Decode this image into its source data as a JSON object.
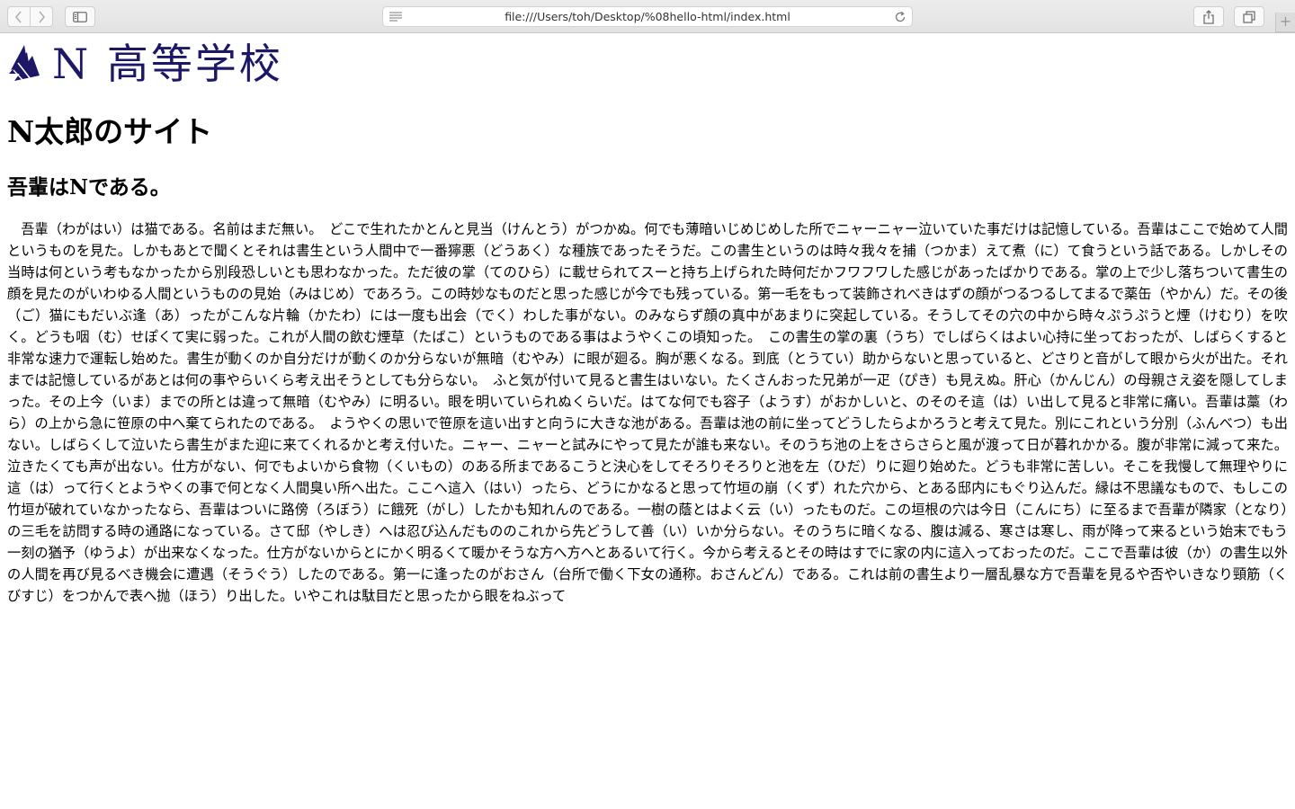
{
  "browser": {
    "url": "file:///Users/toh/Desktop/%08hello-html/index.html",
    "new_tab_label": "+"
  },
  "logo": {
    "text": "N 高等学校",
    "color": "#1c1766"
  },
  "page": {
    "h1": "N太郎のサイト",
    "h2": "吾輩はNである。",
    "paragraph": "　吾輩（わがはい）は猫である。名前はまだ無い。　どこで生れたかとんと見当（けんとう）がつかぬ。何でも薄暗いじめじめした所でニャーニャー泣いていた事だけは記憶している。吾輩はここで始めて人間というものを見た。しかもあとで聞くとそれは書生という人間中で一番獰悪（どうあく）な種族であったそうだ。この書生というのは時々我々を捕（つかま）えて煮（に）て食うという話である。しかしその当時は何という考もなかったから別段恐しいとも思わなかった。ただ彼の掌（てのひら）に載せられてスーと持ち上げられた時何だかフワフワした感じがあったばかりである。掌の上で少し落ちついて書生の顔を見たのがいわゆる人間というものの見始（みはじめ）であろう。この時妙なものだと思った感じが今でも残っている。第一毛をもって装飾されべきはずの顔がつるつるしてまるで薬缶（やかん）だ。その後（ご）猫にもだいぶ逢（あ）ったがこんな片輪（かたわ）には一度も出会（でく）わした事がない。のみならず顔の真中があまりに突起している。そうしてその穴の中から時々ぷうぷうと煙（けむり）を吹く。どうも咽（む）せぽくて実に弱った。これが人間の飲む煙草（たばこ）というものである事はようやくこの頃知った。　この書生の掌の裏（うち）でしばらくはよい心持に坐っておったが、しばらくすると非常な速力で運転し始めた。書生が動くのか自分だけが動くのか分らないが無暗（むやみ）に眼が廻る。胸が悪くなる。到底（とうてい）助からないと思っていると、どさりと音がして眼から火が出た。それまでは記憶しているがあとは何の事やらいくら考え出そうとしても分らない。　ふと気が付いて見ると書生はいない。たくさんおった兄弟が一疋（ぴき）も見えぬ。肝心（かんじん）の母親さえ姿を隠してしまった。その上今（いま）までの所とは違って無暗（むやみ）に明るい。眼を明いていられぬくらいだ。はてな何でも容子（ようす）がおかしいと、のそのそ這（は）い出して見ると非常に痛い。吾輩は藁（わら）の上から急に笹原の中へ棄てられたのである。　ようやくの思いで笹原を這い出すと向うに大きな池がある。吾輩は池の前に坐ってどうしたらよかろうと考えて見た。別にこれという分別（ふんべつ）も出ない。しばらくして泣いたら書生がまた迎に来てくれるかと考え付いた。ニャー、ニャーと試みにやって見たが誰も来ない。そのうち池の上をさらさらと風が渡って日が暮れかかる。腹が非常に減って来た。泣きたくても声が出ない。仕方がない、何でもよいから食物（くいもの）のある所まであるこうと決心をしてそろりそろりと池を左（ひだ）りに廻り始めた。どうも非常に苦しい。そこを我慢して無理やりに這（は）って行くとようやくの事で何となく人間臭い所へ出た。ここへ這入（はい）ったら、どうにかなると思って竹垣の崩（くず）れた穴から、とある邸内にもぐり込んだ。縁は不思議なもので、もしこの竹垣が破れていなかったなら、吾輩はついに路傍（ろぼう）に餓死（がし）したかも知れんのである。一樹の蔭とはよく云（い）ったものだ。この垣根の穴は今日（こんにち）に至るまで吾輩が隣家（となり）の三毛を訪問する時の通路になっている。さて邸（やしき）へは忍び込んだもののこれから先どうして善（い）いか分らない。そのうちに暗くなる、腹は減る、寒さは寒し、雨が降って来るという始末でもう一刻の猶予（ゆうよ）が出来なくなった。仕方がないからとにかく明るくて暖かそうな方へ方へとあるいて行く。今から考えるとその時はすでに家の内に這入っておったのだ。ここで吾輩は彼（か）の書生以外の人間を再び見るべき機会に遭遇（そうぐう）したのである。第一に逢ったのがおさん（台所で働く下女の通称。おさんどん）である。これは前の書生より一層乱暴な方で吾輩を見るや否やいきなり頸筋（くびすじ）をつかんで表へ抛（ほう）り出した。いやこれは駄目だと思ったから眼をねぶって"
  }
}
